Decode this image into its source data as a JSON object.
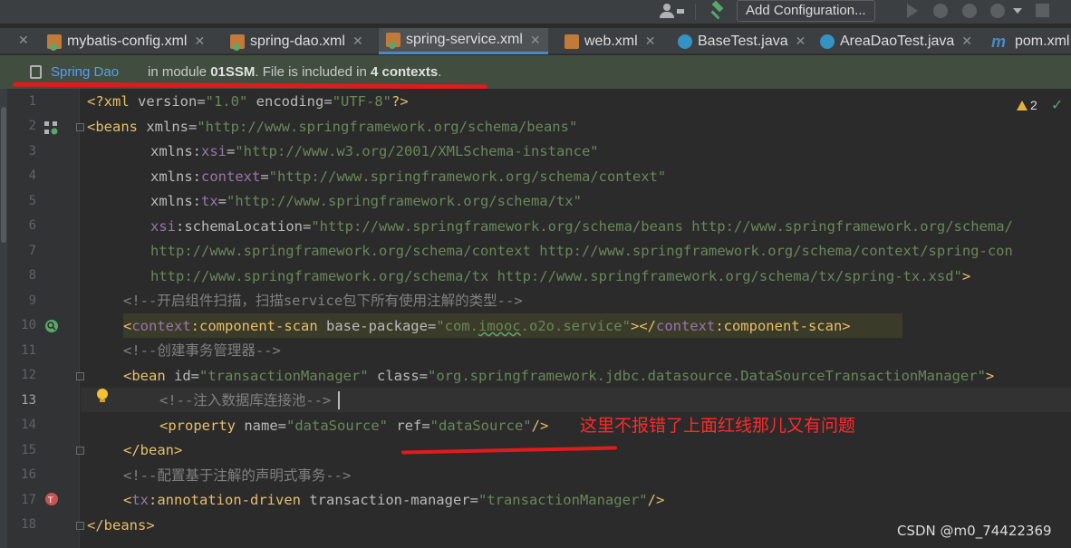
{
  "toolbar": {
    "add_configuration": "Add Configuration..."
  },
  "tabs": [
    {
      "label": "mybatis-config.xml",
      "icon": "xml-file-icon"
    },
    {
      "label": "spring-dao.xml",
      "icon": "xml-file-icon"
    },
    {
      "label": "spring-service.xml",
      "icon": "xml-file-icon",
      "active": true
    },
    {
      "label": "web.xml",
      "icon": "web-xml-icon"
    },
    {
      "label": "BaseTest.java",
      "icon": "class-icon"
    },
    {
      "label": "AreaDaoTest.java",
      "icon": "class-icon"
    },
    {
      "label": "pom.xml",
      "icon": "maven-icon"
    }
  ],
  "banner": {
    "link": "Spring Dao",
    "text_prefix": "in module ",
    "module": "01SSM",
    "text_mid": ". File is included in ",
    "contexts": "4 contexts",
    "text_end": "."
  },
  "inspections": {
    "warnings": "2",
    "check": "✓"
  },
  "line_numbers": [
    "1",
    "2",
    "3",
    "4",
    "5",
    "6",
    "7",
    "8",
    "9",
    "10",
    "11",
    "12",
    "13",
    "14",
    "15",
    "16",
    "17",
    "18"
  ],
  "code": {
    "l1": {
      "p1": "<?xml ",
      "a1": "version",
      "e1": "=",
      "v1": "\"1.0\"",
      "a2": " encoding",
      "e2": "=",
      "v2": "\"UTF-8\"",
      "p2": "?>"
    },
    "l2": {
      "t": "<beans ",
      "a": "xmlns",
      "e": "=",
      "v": "\"http://www.springframework.org/schema/beans\""
    },
    "l3": {
      "a": "xmlns:",
      "ns": "xsi",
      "e": "=",
      "v": "\"http://www.w3.org/2001/XMLSchema-instance\""
    },
    "l4": {
      "a": "xmlns:",
      "ns": "context",
      "e": "=",
      "v": "\"http://www.springframework.org/schema/context\""
    },
    "l5": {
      "a": "xmlns:",
      "ns": "tx",
      "e": "=",
      "v": "\"http://www.springframework.org/schema/tx\""
    },
    "l6": {
      "ns": "xsi",
      "a": ":schemaLocation",
      "e": "=",
      "v": "\"http://www.springframework.org/schema/beans http://www.springframework.org/schema/"
    },
    "l7": {
      "v": "http://www.springframework.org/schema/context http://www.springframework.org/schema/context/spring-con"
    },
    "l8": {
      "v": "http://www.springframework.org/schema/tx http://www.springframework.org/schema/tx/spring-tx.xsd\"",
      "t": ">"
    },
    "l9": {
      "c": "<!--开启组件扫描，扫描service包下所有使用注解的类型-->"
    },
    "l10": {
      "t1": "<",
      "ns1": "context",
      "t2": ":component-scan ",
      "a": "base-package",
      "e": "=",
      "v1": "\"com.",
      "v2": "imooc",
      "v3": ".o2o.service\"",
      "t3": "></",
      "ns2": "context",
      "t4": ":component-scan>"
    },
    "l11": {
      "c": "<!--创建事务管理器-->"
    },
    "l12": {
      "t1": "<bean ",
      "a1": "id",
      "e1": "=",
      "v1": "\"transactionManager\"",
      "a2": " class",
      "e2": "=",
      "v2": "\"org.springframework.jdbc.datasource.DataSourceTransactionManager\"",
      "t2": ">"
    },
    "l13": {
      "c": "<!--注入数据库连接池-->"
    },
    "l14": {
      "t1": "<property ",
      "a1": "name",
      "e1": "=",
      "v1": "\"dataSource\"",
      "a2": " ref",
      "e2": "=",
      "v2": "\"dataSource\"",
      "t2": "/>"
    },
    "l15": {
      "t": "</bean>"
    },
    "l16": {
      "c": "<!--配置基于注解的声明式事务-->"
    },
    "l17": {
      "t1": "<",
      "ns": "tx",
      "t2": ":annotation-driven ",
      "a": "transaction-manager",
      "e": "=",
      "v": "\"transactionManager\"",
      "t3": "/>"
    },
    "l18": {
      "t": "</beans>"
    }
  },
  "annotation_note": "这里不报错了上面红线那儿又有问题",
  "watermark": "CSDN @m0_74422369",
  "colors": {
    "tag": "#e8bf6a",
    "attribute": "#bababa",
    "value": "#6a8759",
    "namespace": "#9876aa",
    "comment": "#808080",
    "annotation_red": "#ff2a2a",
    "link": "#589df6"
  }
}
